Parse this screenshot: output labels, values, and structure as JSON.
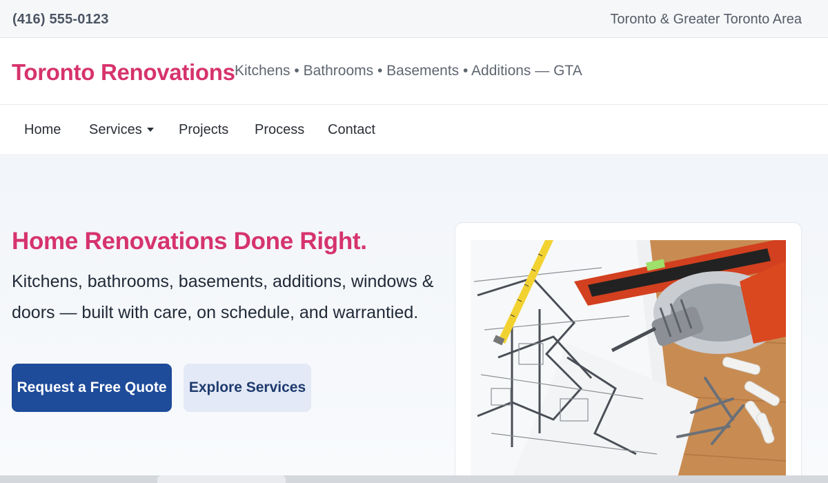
{
  "topbar": {
    "phone": "(416) 555-0123",
    "service_area": "Toronto & Greater Toronto Area"
  },
  "header": {
    "brand": "Toronto Renovations",
    "tagline": "Kitchens • Bathrooms • Basements • Additions — GTA"
  },
  "nav": {
    "items": [
      {
        "label": "Home"
      },
      {
        "label": "Services",
        "has_dropdown": true
      },
      {
        "label": "Projects"
      },
      {
        "label": "Process"
      },
      {
        "label": "Contact"
      }
    ]
  },
  "hero": {
    "title": "Home Renovations Done Right.",
    "subtitle": "Kitchens, bathrooms, basements, additions, windows & doors — built with care, on schedule, and warrantied.",
    "primary_button": "Request a Free Quote",
    "secondary_button": "Explore Services"
  },
  "colors": {
    "brand": "#d6336c",
    "primary_button": "#1e4b9a",
    "secondary_button": "#e3e9f6"
  },
  "icons": {
    "dropdown": "chevron-down-icon"
  }
}
